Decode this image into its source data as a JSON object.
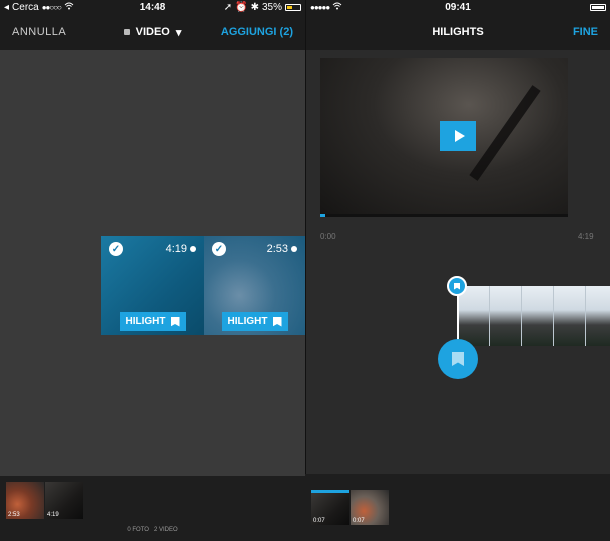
{
  "left_screen": {
    "statusbar": {
      "carrier": "Cerca",
      "time": "14:48",
      "battery": "35%"
    },
    "navbar": {
      "cancel": "ANNULLA",
      "title": "VIDEO",
      "add": "AGGIUNGI (2)"
    },
    "clips": [
      {
        "duration": "4:19",
        "button": "HILIGHT",
        "selected": true
      },
      {
        "duration": "2:53",
        "button": "HILIGHT",
        "selected": true
      }
    ],
    "tray": {
      "thumbs": [
        {
          "duration": "2:53"
        },
        {
          "duration": "4:19"
        }
      ],
      "count_photos": "0 FOTO",
      "count_videos": "2 VIDEO"
    }
  },
  "right_screen": {
    "statusbar": {
      "time": "09:41"
    },
    "navbar": {
      "title": "HILIGHTS",
      "done": "FINE"
    },
    "player": {
      "time_start": "0:00",
      "time_end": "4:19",
      "progress": 0.01
    },
    "tray": {
      "thumbs": [
        {
          "duration": "0:07"
        },
        {
          "duration": "0:07"
        }
      ]
    }
  },
  "colors": {
    "accent": "#1ea3e0",
    "battery_low": "#f5c518"
  },
  "icons": {
    "check": "✓",
    "play": "play-icon",
    "tag": "hilight-tag-icon",
    "chevron": "▾",
    "wifi": "wifi-icon",
    "location": "➚",
    "alarm": "⏰",
    "bluetooth": "✱"
  }
}
